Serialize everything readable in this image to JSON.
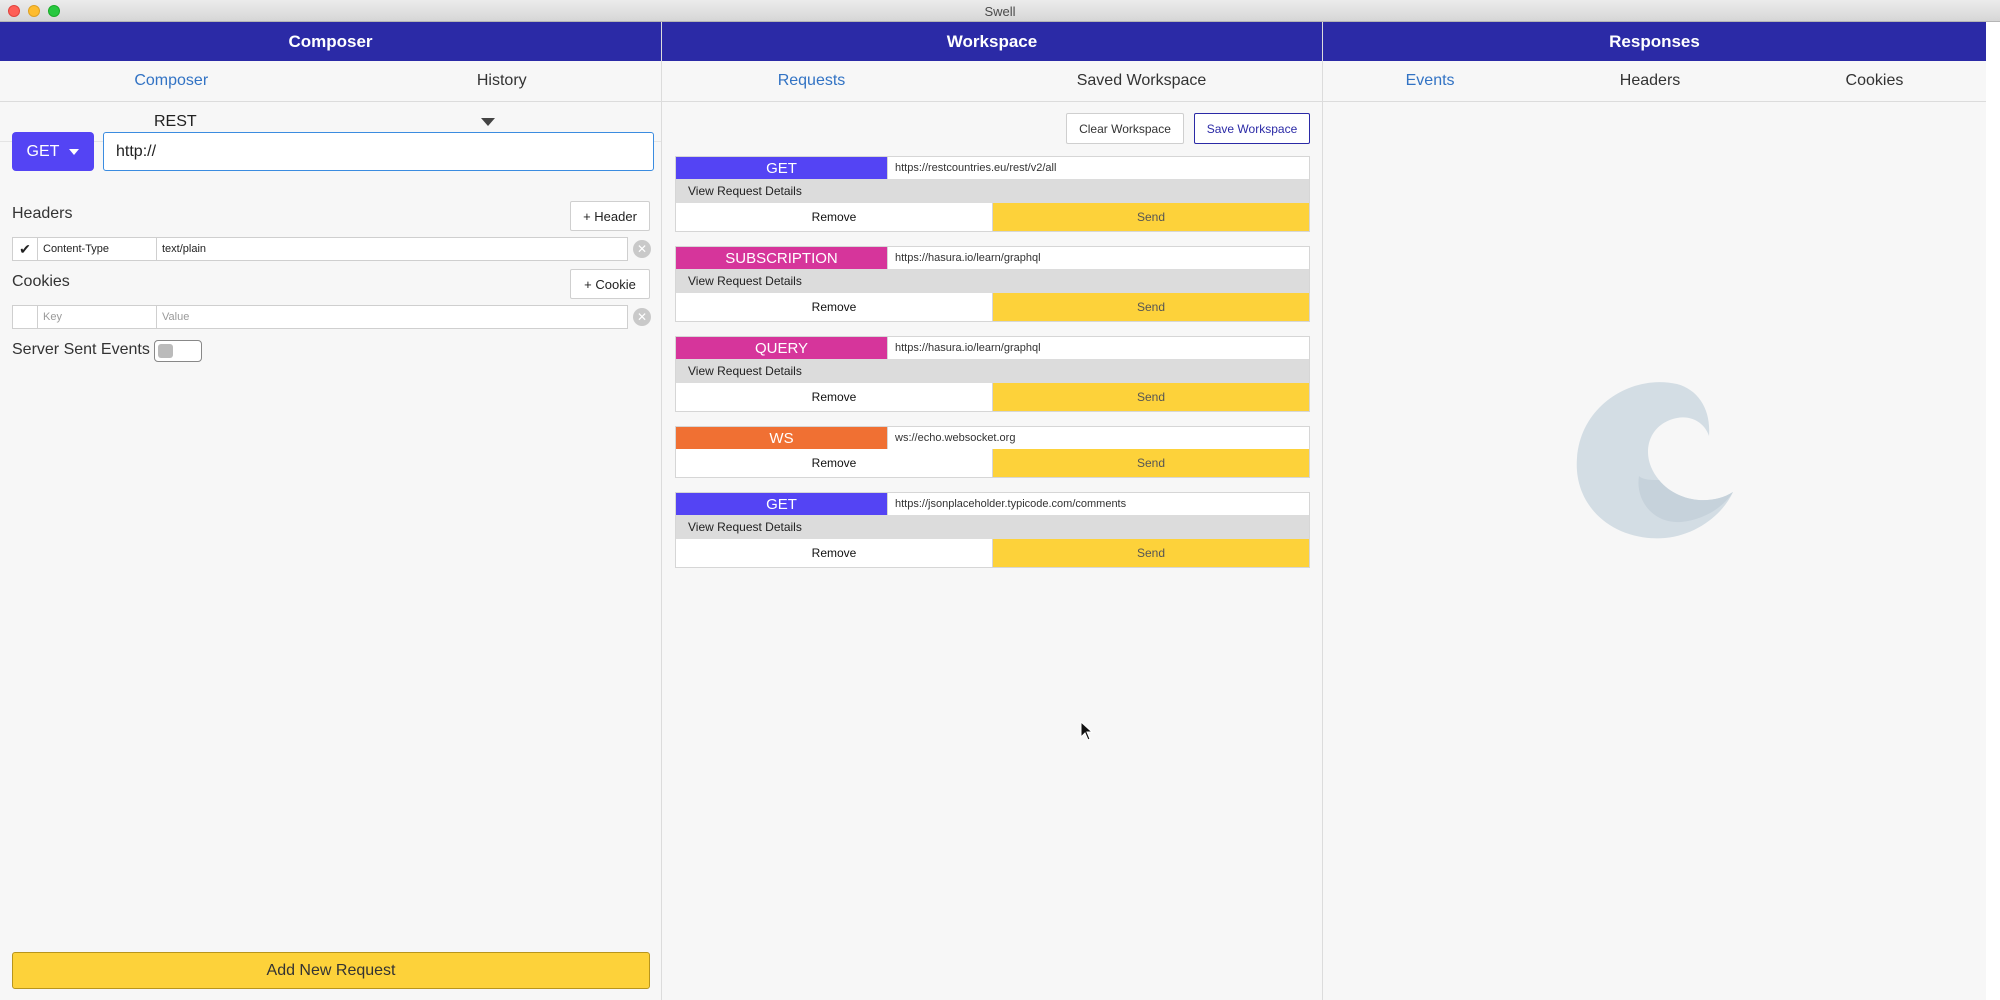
{
  "window": {
    "title": "Swell"
  },
  "composer": {
    "header": "Composer",
    "tabs": [
      {
        "label": "Composer",
        "active": true
      },
      {
        "label": "History",
        "active": false
      }
    ],
    "protocol": "REST",
    "method": "GET",
    "url": "http://",
    "headers_label": "Headers",
    "add_header_label": "+ Header",
    "headers": [
      {
        "checked": true,
        "key": "Content-Type",
        "value": "text/plain"
      }
    ],
    "cookies_label": "Cookies",
    "add_cookie_label": "+ Cookie",
    "cookie_key_placeholder": "Key",
    "cookie_value_placeholder": "Value",
    "sse_label": "Server Sent Events",
    "sse_enabled": false,
    "add_request_label": "Add New Request"
  },
  "workspace": {
    "header": "Workspace",
    "tabs": [
      {
        "label": "Requests",
        "active": true
      },
      {
        "label": "Saved Workspace",
        "active": false
      }
    ],
    "clear_label": "Clear Workspace",
    "save_label": "Save Workspace",
    "details_label": "View Request Details",
    "remove_label": "Remove",
    "send_label": "Send",
    "requests": [
      {
        "method": "GET",
        "url": "https://restcountries.eu/rest/v2/all",
        "color": "#5444f4",
        "has_details": true
      },
      {
        "method": "SUBSCRIPTION",
        "url": "https://hasura.io/learn/graphql",
        "color": "#d6359b",
        "has_details": true
      },
      {
        "method": "QUERY",
        "url": "https://hasura.io/learn/graphql",
        "color": "#d6359b",
        "has_details": true
      },
      {
        "method": "WS",
        "url": "ws://echo.websocket.org",
        "color": "#f07033",
        "has_details": false
      },
      {
        "method": "GET",
        "url": "https://jsonplaceholder.typicode.com/comments",
        "color": "#5444f4",
        "has_details": true
      }
    ]
  },
  "responses": {
    "header": "Responses",
    "tabs": [
      {
        "label": "Events",
        "active": true
      },
      {
        "label": "Headers",
        "active": false
      },
      {
        "label": "Cookies",
        "active": false
      }
    ]
  },
  "colors": {
    "header_bg": "#2b2aa6",
    "accent": "#5444f4",
    "send_yellow": "#fdd23a",
    "tab_active": "#3273c4"
  }
}
